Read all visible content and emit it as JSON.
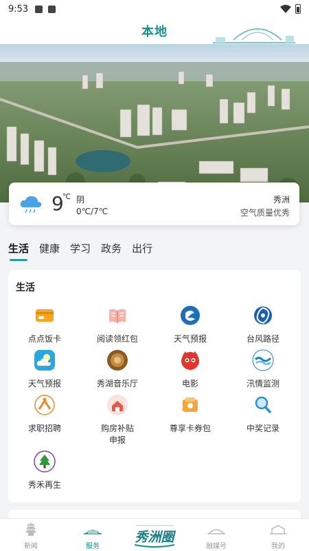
{
  "status_bar": {
    "time": "9:53"
  },
  "header": {
    "title": "本地"
  },
  "weather": {
    "temp": "9",
    "unit": "℃",
    "condition": "阴",
    "range": "0℃/7℃",
    "city": "秀洲",
    "aqi": "空气质量优秀"
  },
  "tabs": [
    "生活",
    "健康",
    "学习",
    "政务",
    "出行"
  ],
  "section": {
    "title": "生活",
    "items": [
      {
        "label": "点点饭卡",
        "icon": "card-icon"
      },
      {
        "label": "阅读领红包",
        "icon": "book-icon"
      },
      {
        "label": "天气预报",
        "icon": "weather-logo-icon"
      },
      {
        "label": "台风路径",
        "icon": "typhoon-icon"
      },
      {
        "label": "天气预报",
        "icon": "cloud-sun-icon"
      },
      {
        "label": "秀湖音乐厅",
        "icon": "concert-hall-icon"
      },
      {
        "label": "电影",
        "icon": "movie-cat-icon"
      },
      {
        "label": "汛情监测",
        "icon": "flood-monitor-icon"
      },
      {
        "label": "求职招聘",
        "icon": "job-icon"
      },
      {
        "label": "购房补贴申报",
        "icon": "house-subsidy-icon"
      },
      {
        "label": "尊享卡券包",
        "icon": "coupon-icon"
      },
      {
        "label": "中奖记录",
        "icon": "search-record-icon"
      },
      {
        "label": "秀禾再生",
        "icon": "tree-icon"
      }
    ]
  },
  "bottom_nav": {
    "items": [
      {
        "label": "新闻"
      },
      {
        "label": "服务"
      },
      {
        "label": "秀洲圈"
      },
      {
        "label": "融媒号"
      },
      {
        "label": "我的"
      }
    ]
  },
  "colors": {
    "accent": "#1a8f8f",
    "tab_underline": "#2a9aa0"
  }
}
